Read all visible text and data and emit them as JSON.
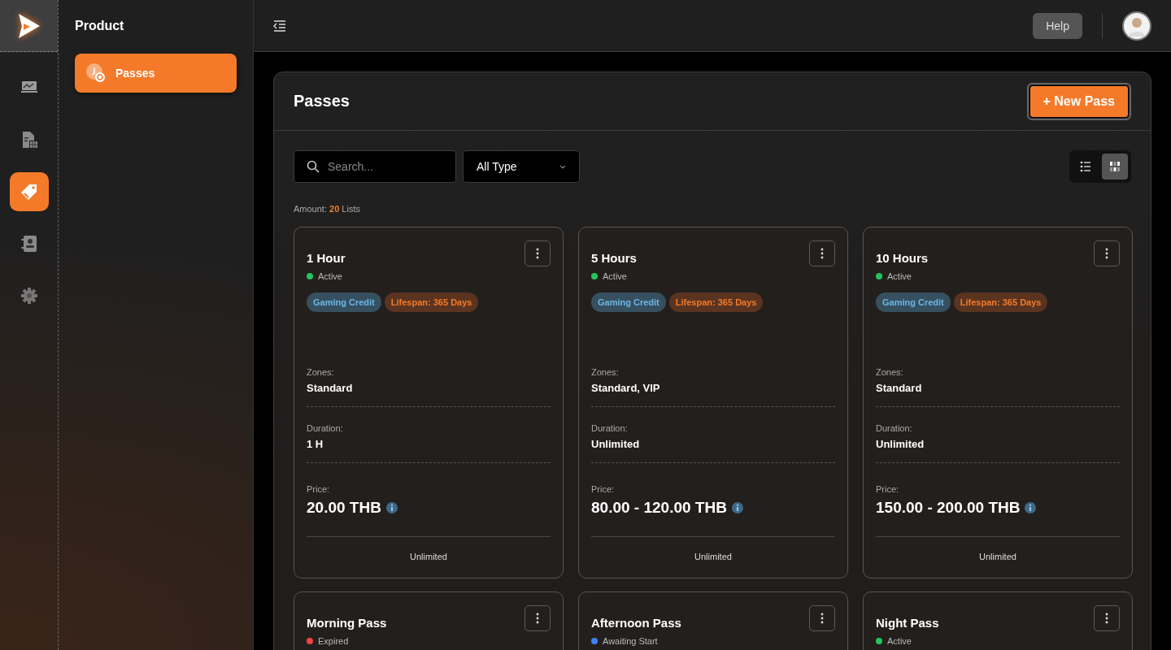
{
  "rail": {
    "items": [
      {
        "selected": false
      },
      {
        "selected": false
      },
      {
        "selected": true
      },
      {
        "selected": false
      },
      {
        "selected": false
      }
    ]
  },
  "sidebar": {
    "title": "Product",
    "items": [
      {
        "label": "Passes",
        "selected": true
      }
    ]
  },
  "topbar": {
    "help": "Help"
  },
  "panel": {
    "title": "Passes",
    "new_button": "+ New Pass",
    "search": {
      "placeholder": "Search..."
    },
    "type_filter": {
      "value": "All Type"
    },
    "view_toggle": [
      {
        "selected": false
      },
      {
        "selected": true
      }
    ],
    "amount": "Amount: **20** Lists",
    "cards": [
      {
        "title": "1 Hour",
        "status": {
          "label": "Active",
          "color": "#22c55e"
        },
        "tags": [
          {
            "label": "Gaming Credit",
            "kind": "type"
          },
          {
            "label": "Lifespan: 365 Days",
            "kind": "lifespan"
          }
        ],
        "zones_label": "Zones:",
        "zones": "Standard",
        "duration_label": "Duration:",
        "duration": "1 H",
        "price_label": "Price:",
        "price": "20.00 THB",
        "footer": "Unlimited"
      },
      {
        "title": "5 Hours",
        "status": {
          "label": "Active",
          "color": "#22c55e"
        },
        "tags": [
          {
            "label": "Gaming Credit",
            "kind": "type"
          },
          {
            "label": "Lifespan: 365 Days",
            "kind": "lifespan"
          }
        ],
        "zones_label": "Zones:",
        "zones": "Standard, VIP",
        "duration_label": "Duration:",
        "duration": "Unlimited",
        "price_label": "Price:",
        "price": "80.00 - 120.00 THB",
        "footer": "Unlimited"
      },
      {
        "title": "10 Hours",
        "status": {
          "label": "Active",
          "color": "#22c55e"
        },
        "tags": [
          {
            "label": "Gaming Credit",
            "kind": "type"
          },
          {
            "label": "Lifespan: 365 Days",
            "kind": "lifespan"
          }
        ],
        "zones_label": "Zones:",
        "zones": "Standard",
        "duration_label": "Duration:",
        "duration": "Unlimited",
        "price_label": "Price:",
        "price": "150.00 - 200.00 THB",
        "footer": "Unlimited"
      },
      {
        "title": "Morning Pass",
        "status": {
          "label": "Expired",
          "color": "#ef4444"
        }
      },
      {
        "title": "Afternoon Pass",
        "status": {
          "label": "Awaiting Start",
          "color": "#3b82f6"
        }
      },
      {
        "title": "Night Pass",
        "status": {
          "label": "Active",
          "color": "#22c55e"
        }
      }
    ]
  }
}
